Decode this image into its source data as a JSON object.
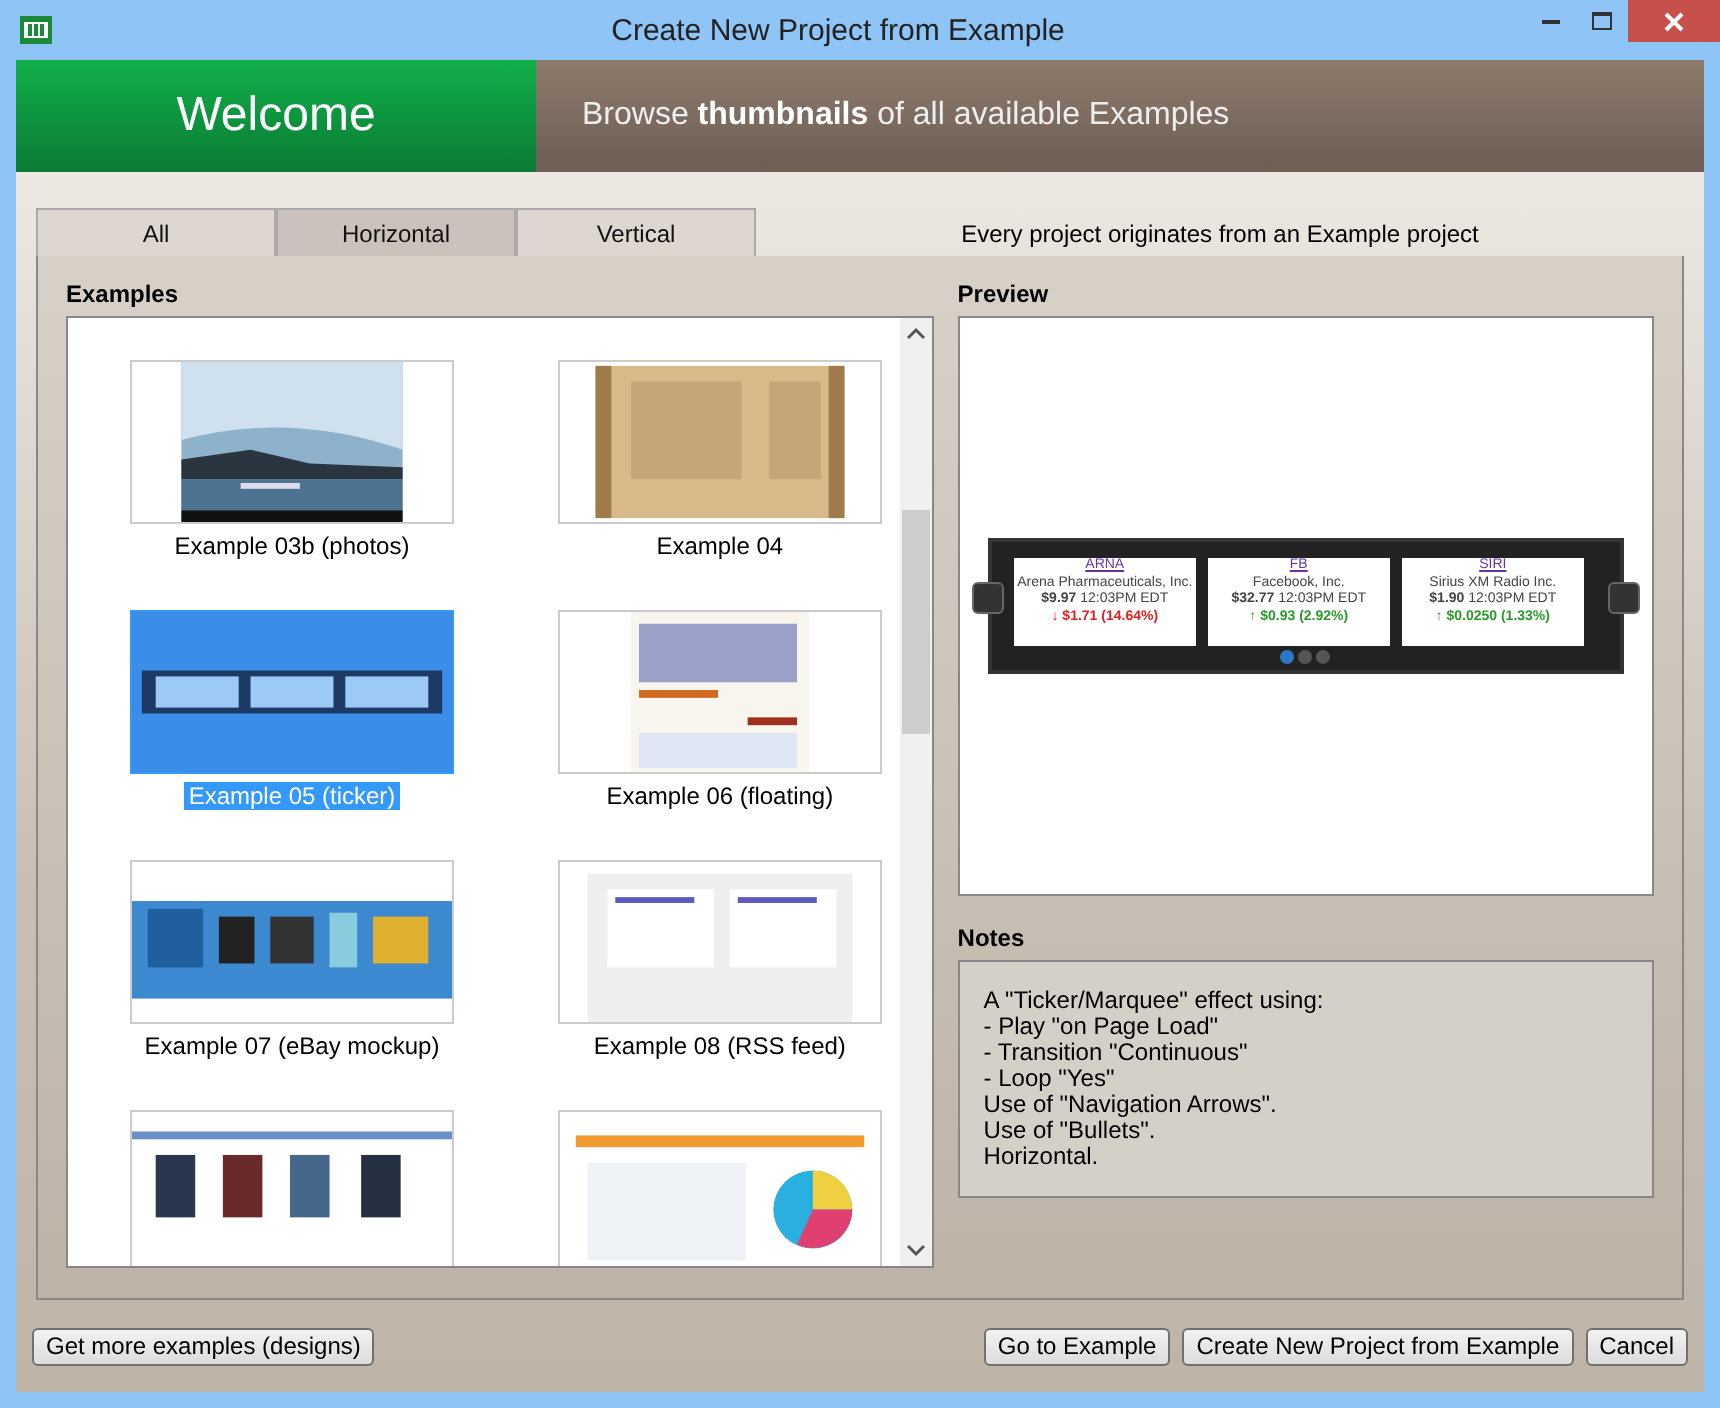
{
  "window": {
    "title": "Create New Project from Example"
  },
  "header": {
    "welcome": "Welcome",
    "tagline": "Browse **thumbnails** of all available Examples"
  },
  "tabs": [
    {
      "label": "All",
      "selected": false
    },
    {
      "label": "Horizontal",
      "selected": true
    },
    {
      "label": "Vertical",
      "selected": false
    }
  ],
  "tab_caption": "Every project originates from an Example project",
  "examples": {
    "title": "Examples",
    "items": [
      {
        "label": "Example 03b (photos)",
        "kind": "picture",
        "selected": false
      },
      {
        "label": "Example 04",
        "kind": "picture",
        "selected": false
      },
      {
        "label": "Example 05 (ticker)",
        "kind": "picture",
        "selected": true
      },
      {
        "label": "Example 06 (floating)",
        "kind": "picture",
        "selected": false
      },
      {
        "label": "Example 07 (eBay mockup)",
        "kind": "picture",
        "selected": false
      },
      {
        "label": "Example 08 (RSS feed)",
        "kind": "picture",
        "selected": false
      },
      {
        "kind": "picture",
        "selected": false
      },
      {
        "kind": "picture",
        "selected": false
      }
    ]
  },
  "preview": {
    "title": "Preview",
    "tickers": [
      {
        "symbol": "ARNA",
        "company": "Arena Pharmaceuticals, Inc.",
        "price": "$9.97",
        "time": "12:03PM EDT",
        "change": "↓ $1.71 (14.64%)",
        "color": "#e02020"
      },
      {
        "symbol": "FB",
        "company": "Facebook, Inc.",
        "price": "$32.77",
        "time": "12:03PM EDT",
        "change": "↑ $0.93 (2.92%)",
        "color": "#2a9a2a"
      },
      {
        "symbol": "SIRI",
        "company": "Sirius XM Radio Inc.",
        "price": "$1.90",
        "time": "12:03PM EDT",
        "change": "↑ $0.0250 (1.33%)",
        "color": "#2a9a2a"
      }
    ],
    "bullets": [
      {
        "selected": true
      },
      {
        "selected": false
      },
      {
        "selected": false
      }
    ]
  },
  "notes": {
    "title": "Notes",
    "lines": [
      "A \"Ticker/Marquee\" effect using:",
      "- Play \"on Page Load\"",
      "- Transition \"Continuous\"",
      "- Loop \"Yes\"",
      "Use of \"Navigation Arrows\".",
      "Use of \"Bullets\".",
      "Horizontal."
    ]
  },
  "buttons_left": [
    "Get more examples (designs)"
  ],
  "buttons_right": [
    "Go to Example",
    "Create New Project from Example",
    "Cancel"
  ]
}
